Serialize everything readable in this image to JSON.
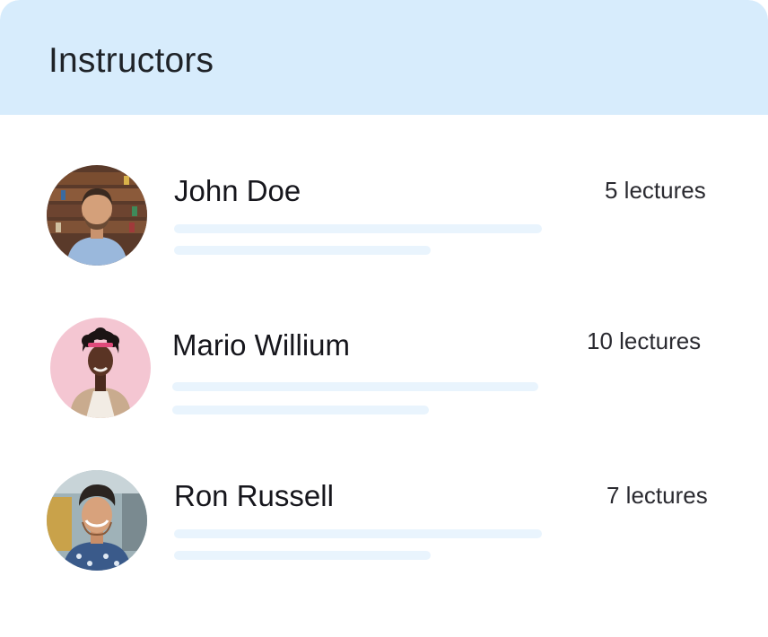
{
  "header": {
    "title": "Instructors"
  },
  "instructors": [
    {
      "name": "John Doe",
      "lectures": "5 lectures",
      "avatar_icon": "person-photo-bookshelf-background"
    },
    {
      "name": "Mario Willium",
      "lectures": "10 lectures",
      "avatar_icon": "person-photo-pink-background"
    },
    {
      "name": "Ron Russell",
      "lectures": "7 lectures",
      "avatar_icon": "person-photo-street-background"
    }
  ],
  "colors": {
    "header_bg": "#d7ecfc",
    "placeholder_bar": "#e9f4fd",
    "text": "#16161c"
  }
}
